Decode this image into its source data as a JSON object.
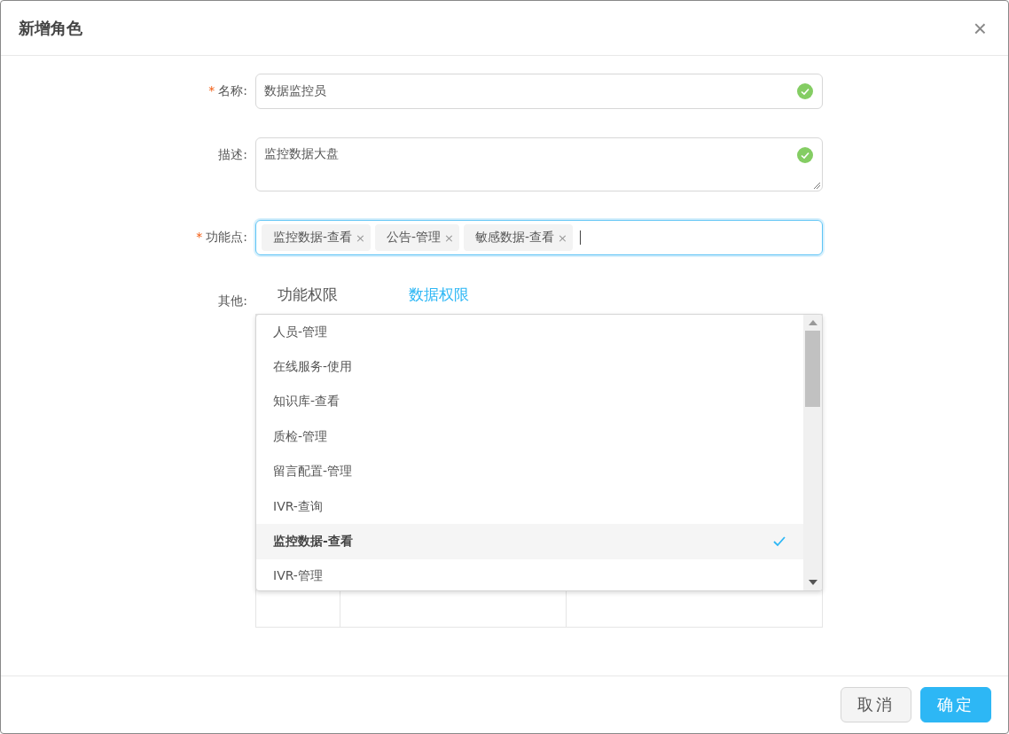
{
  "dialog": {
    "title": "新增角色",
    "close": "×"
  },
  "form": {
    "name": {
      "label": "名称:",
      "required_mark": "*",
      "value": "数据监控员",
      "valid": true
    },
    "description": {
      "label": "描述:",
      "value": "监控数据大盘",
      "valid": true
    },
    "features": {
      "label": "功能点:",
      "required_mark": "*",
      "tags": [
        {
          "label": "监控数据-查看",
          "remove": "×"
        },
        {
          "label": "公告-管理",
          "remove": "×"
        },
        {
          "label": "敏感数据-查看",
          "remove": "×"
        }
      ]
    },
    "other": {
      "label": "其他:",
      "tabs": [
        {
          "label": "功能权限",
          "selected": false
        },
        {
          "label": "数据权限",
          "selected": true
        }
      ]
    }
  },
  "dropdown": {
    "items": [
      {
        "label": "人员-管理",
        "selected": false
      },
      {
        "label": "在线服务-使用",
        "selected": false
      },
      {
        "label": "知识库-查看",
        "selected": false
      },
      {
        "label": "质检-管理",
        "selected": false
      },
      {
        "label": "留言配置-管理",
        "selected": false
      },
      {
        "label": "IVR-查询",
        "selected": false
      },
      {
        "label": "监控数据-查看",
        "selected": true
      },
      {
        "label": "IVR-管理",
        "selected": false
      }
    ]
  },
  "buttons": [
    {
      "label": "取消",
      "kind": "secondary"
    },
    {
      "label": "确定",
      "kind": "primary"
    }
  ]
}
